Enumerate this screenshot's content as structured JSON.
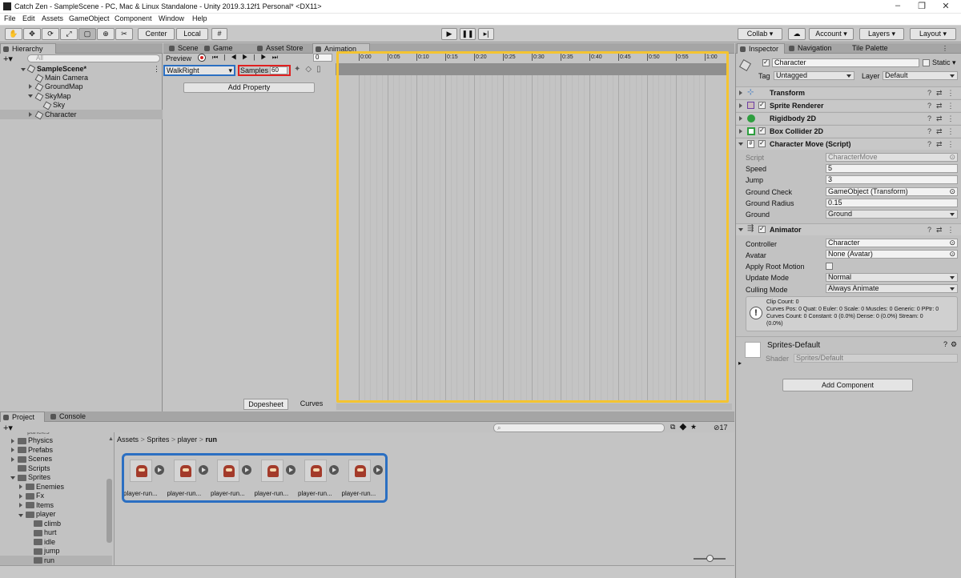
{
  "window": {
    "title": "Catch Zen - SampleScene - PC, Mac & Linux Standalone - Unity 2019.3.12f1 Personal* <DX11>",
    "controls": [
      "–",
      "❐",
      "✕"
    ]
  },
  "menu": [
    "File",
    "Edit",
    "Assets",
    "GameObject",
    "Component",
    "Window",
    "Help"
  ],
  "toolbar": {
    "pivot_center": "Center",
    "pivot_local": "Local",
    "collab": "Collab ▾",
    "account": "Account",
    "layers": "Layers",
    "layout": "Layout"
  },
  "hierarchy": {
    "tab": "Hierarchy",
    "search_placeholder": "All",
    "scene": "SampleScene*",
    "items": [
      "Main Camera",
      "GroundMap",
      "SkyMap",
      "Sky",
      "Character"
    ]
  },
  "center_tabs": [
    "Scene",
    "Game",
    "Asset Store",
    "Animation"
  ],
  "animation": {
    "preview": "Preview",
    "frame": "0",
    "clip": "WalkRight",
    "samples_label": "Samples",
    "samples_value": "60",
    "add_property": "Add Property",
    "bottom_tabs": [
      "Dopesheet",
      "Curves"
    ],
    "ticks": [
      "0:00",
      "0:05",
      "0:10",
      "0:15",
      "0:20",
      "0:25",
      "0:30",
      "0:35",
      "0:40",
      "0:45",
      "0:50",
      "0:55",
      "1:00"
    ]
  },
  "inspector": {
    "tabs": [
      "Inspector",
      "Navigation",
      "Tile Palette"
    ],
    "object_name": "Character",
    "static_label": "Static",
    "tag_label": "Tag",
    "tag_value": "Untagged",
    "layer_label": "Layer",
    "layer_value": "Default",
    "components": [
      "Transform",
      "Sprite Renderer",
      "Rigidbody 2D",
      "Box Collider 2D",
      "Character Move (Script)"
    ],
    "script_props": [
      {
        "label": "Script",
        "value": "CharacterMove"
      },
      {
        "label": "Speed",
        "value": "5"
      },
      {
        "label": "Jump",
        "value": "3"
      },
      {
        "label": "Ground Check",
        "value": "GameObject (Transform)"
      },
      {
        "label": "Ground Radius",
        "value": "0.15"
      },
      {
        "label": "Ground",
        "value": "Ground"
      }
    ],
    "animator_title": "Animator",
    "animator_props": [
      {
        "label": "Controller",
        "value": "Character"
      },
      {
        "label": "Avatar",
        "value": "None (Avatar)"
      },
      {
        "label": "Apply Root Motion",
        "value": ""
      },
      {
        "label": "Update Mode",
        "value": "Normal"
      },
      {
        "label": "Culling Mode",
        "value": "Always Animate"
      }
    ],
    "info_lines": [
      "Clip Count: 0",
      "Curves Pos: 0 Quat: 0 Euler: 0 Scale: 0 Muscles: 0 Generic: 0 PPtr: 0",
      "Curves Count: 0 Constant: 0 (0.0%) Dense: 0 (0.0%) Stream: 0",
      "(0.0%)"
    ],
    "material_name": "Sprites-Default",
    "shader_label": "Shader",
    "shader_value": "Sprites/Default",
    "add_component": "Add Component"
  },
  "project": {
    "tabs": [
      "Project",
      "Console"
    ],
    "folders": [
      "Physics",
      "Prefabs",
      "Scenes",
      "Scripts",
      "Sprites",
      "Enemies",
      "Fx",
      "Items",
      "player",
      "climb",
      "hurt",
      "idle",
      "jump",
      "run"
    ],
    "breadcrumb": [
      "Assets",
      "Sprites",
      "player",
      "run"
    ],
    "hidden_count": "17",
    "assets": [
      "player-run...",
      "player-run...",
      "player-run...",
      "player-run...",
      "player-run...",
      "player-run..."
    ]
  },
  "colors": {
    "highlight_blue": "#2b6fc2",
    "highlight_red": "#e02020",
    "highlight_yellow": "#f4c430",
    "record_red": "#d62020"
  }
}
